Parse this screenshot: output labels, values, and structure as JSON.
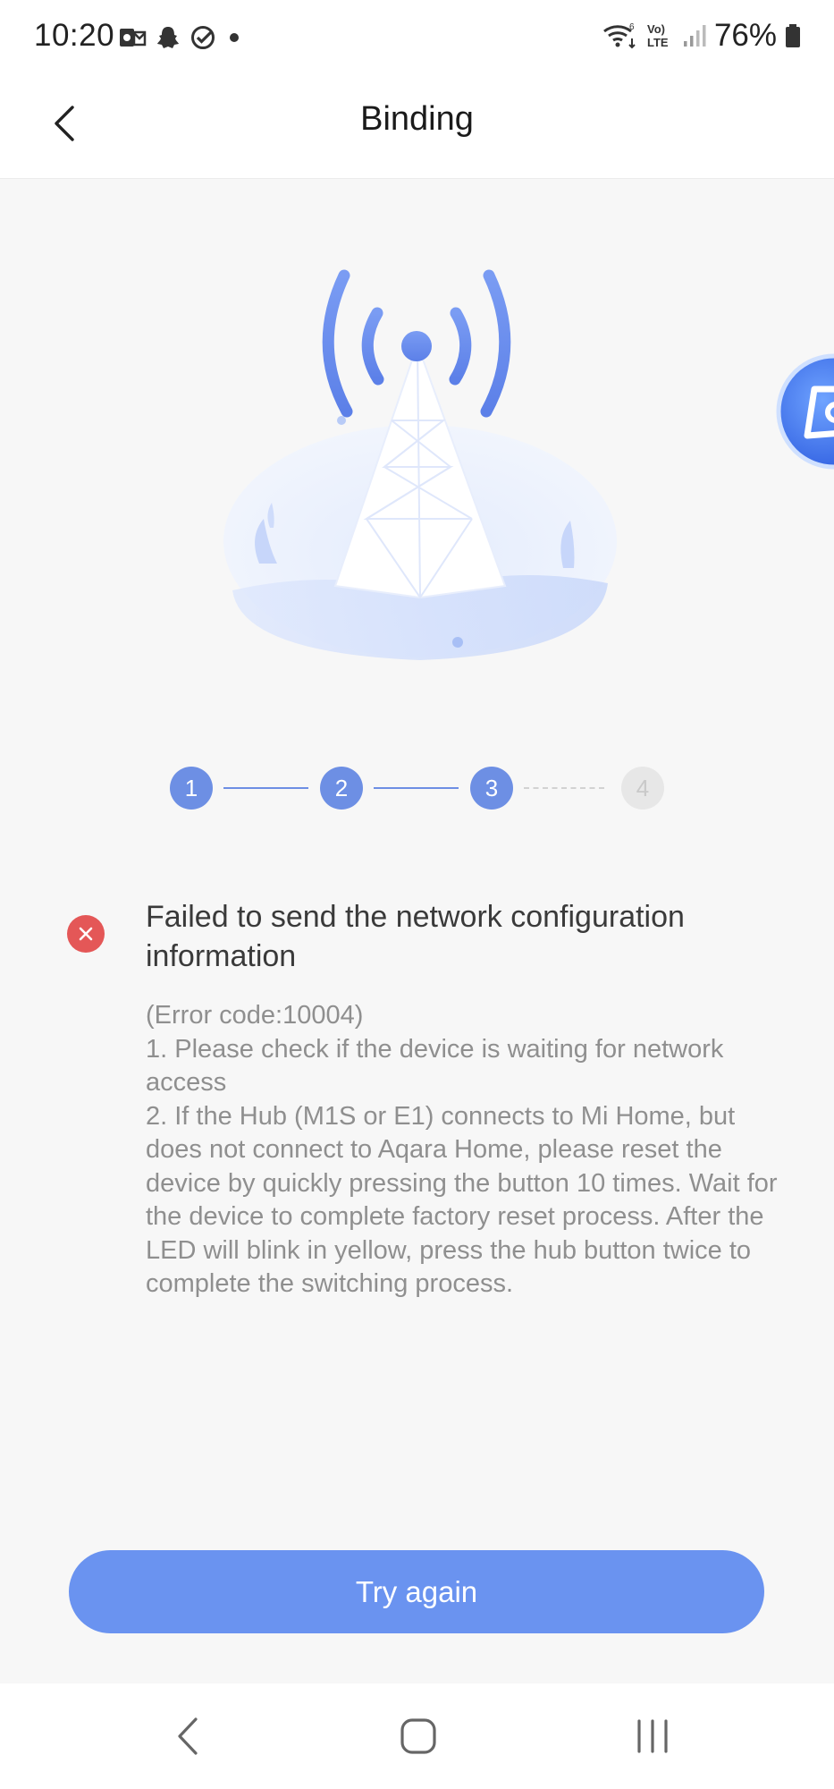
{
  "status_bar": {
    "time": "10:20",
    "battery": "76%",
    "left_icons": [
      "outlook-icon",
      "snapchat-icon",
      "check-circle-icon",
      "dot-icon"
    ],
    "right_icons": [
      "wifi-icon",
      "volte-icon",
      "signal-icon",
      "battery-icon"
    ]
  },
  "header": {
    "title": "Binding"
  },
  "stepper": {
    "steps": [
      {
        "label": "1",
        "state": "done"
      },
      {
        "label": "2",
        "state": "done"
      },
      {
        "label": "3",
        "state": "current"
      },
      {
        "label": "4",
        "state": "pending"
      }
    ]
  },
  "error": {
    "title": "Failed to send the network configuration information",
    "body": "(Error code:10004)\n1. Please check if the device is waiting for network access\n2.  If the Hub (M1S or E1) connects to Mi Home, but does not connect to Aqara Home, please reset the device by quickly pressing the button 10 times. Wait for the device to complete factory reset process. After the LED will blink in yellow, press the hub button twice to complete the switching process."
  },
  "actions": {
    "primary_label": "Try again"
  },
  "colors": {
    "accent": "#6a93f0",
    "error": "#e45757",
    "step_active": "#6d8fe4"
  }
}
